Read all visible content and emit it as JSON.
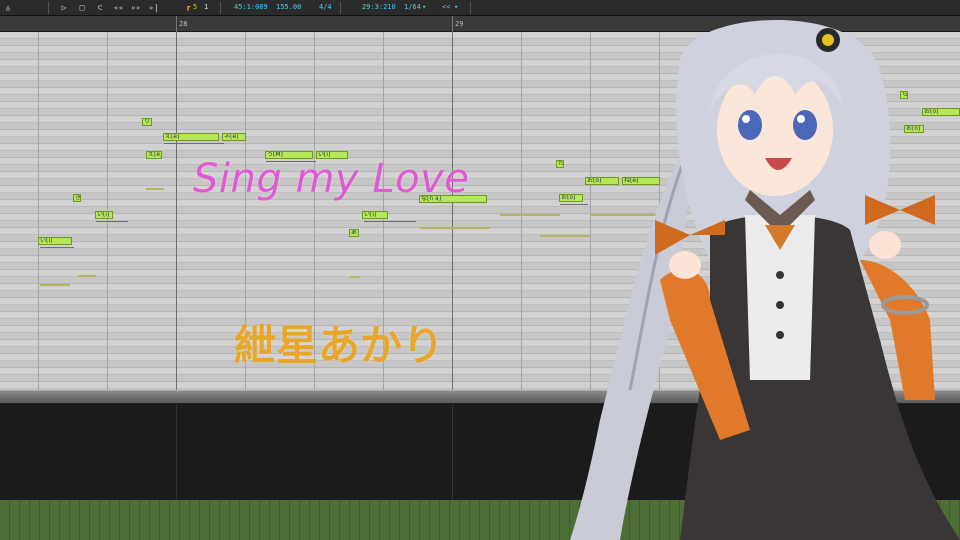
{
  "toolbar": {
    "position": "45:1:089",
    "tempo": "155.00",
    "beat": "4/4",
    "cursor_position": "29:3:210",
    "quantize": "1/64",
    "snap_mode": "<<",
    "track_number": "5",
    "track_number_2": "1"
  },
  "ruler": {
    "measure_a": "28",
    "measure_b": "29"
  },
  "notes": [
    {
      "lyric": "り",
      "label": "り"
    },
    {
      "lyric": "え[e]",
      "label": "え[e]"
    },
    {
      "lyric": "ネ[e]",
      "label": "ネ[e]"
    },
    {
      "lyric": "え[e]",
      "label": "え[e]"
    },
    {
      "lyric": "う[M]",
      "label": "う[M]"
    },
    {
      "lyric": "い[i]",
      "label": "い[i]"
    },
    {
      "lyric": "き",
      "label": "き"
    },
    {
      "lyric": "い[i]",
      "label": "い[i]"
    },
    {
      "lyric": "い[i]",
      "label": "い[i]"
    },
    {
      "lyric": "な[n a]",
      "label": "な[n a]"
    },
    {
      "lyric": "あ",
      "label": "あ"
    },
    {
      "lyric": "い[i]",
      "label": "い[i]"
    },
    {
      "lyric": "お[o]",
      "label": "お[o]"
    },
    {
      "lyric": "ね[e]",
      "label": "ね[e]"
    },
    {
      "lyric": "お[o]",
      "label": "お[o]"
    },
    {
      "lyric": "た",
      "label": "た"
    },
    {
      "lyric": "お[o]",
      "label": "お[o]"
    },
    {
      "lyric": "お[o]",
      "label": "お[o]"
    },
    {
      "lyric": "ら",
      "label": "ら"
    }
  ],
  "overlay": {
    "title": "Sing my Love",
    "singer": "紲星あかり"
  },
  "colors": {
    "title": "#e058d2",
    "singer": "#e8a72a",
    "note_fill": "#b6e65a",
    "accent": "#3fd0ff"
  }
}
